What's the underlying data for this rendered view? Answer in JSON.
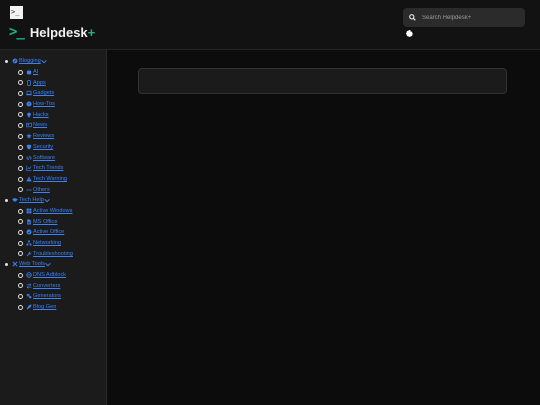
{
  "header": {
    "brand": "Helpdesk",
    "brand_suffix": "+",
    "search_placeholder": "Search Helpdesk+"
  },
  "sidebar": {
    "groups": [
      {
        "label": "Blogging",
        "items": [
          "AI",
          "Apps",
          "Gadgets",
          "How-Tos",
          "Hacks",
          "News",
          "Reviews",
          "Security",
          "Software",
          "Tech Trends",
          "Tech Warning",
          "Others"
        ]
      },
      {
        "label": "Tech Help",
        "items": [
          "Active Windows",
          "MS Office",
          "Active Office",
          "Networking",
          "Troubleshooting"
        ]
      },
      {
        "label": "Web Tools",
        "items": [
          "DNS Adblock",
          "Converters",
          "Generators",
          "Blog Gen"
        ]
      }
    ]
  },
  "colors": {
    "accent": "#1fb28a",
    "link": "#3b82f6",
    "background": "#0c0c0c",
    "sidebar": "#1b1b1b"
  }
}
